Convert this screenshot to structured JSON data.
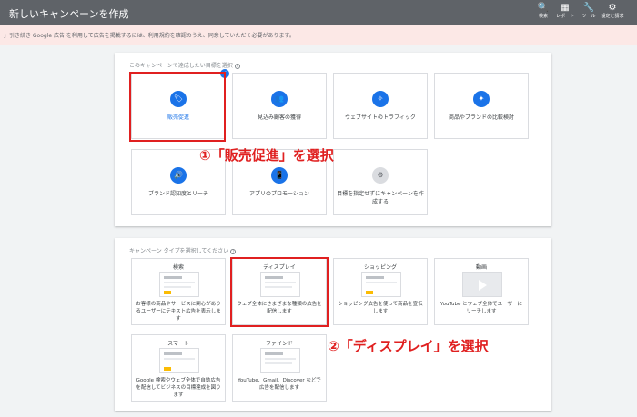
{
  "header": {
    "title": "新しいキャンペーンを作成",
    "tools": [
      {
        "icon": "search-icon",
        "glyph": "🔍",
        "label": "検索"
      },
      {
        "icon": "report-icon",
        "glyph": "▦",
        "label": "レポート"
      },
      {
        "icon": "wrench-icon",
        "glyph": "🔧",
        "label": "ツール"
      },
      {
        "icon": "gear-icon",
        "glyph": "⚙",
        "label": "設定と請求"
      }
    ]
  },
  "notice": {
    "text": "」引き続き Google 広告 を利用して広告を掲載するには、利用規約を確認のうえ、同意していただく必要があります。"
  },
  "objective_section": {
    "heading": "このキャンペーンで達成したい目標を選択",
    "help_glyph": "?",
    "items": [
      {
        "label": "販売促進",
        "icon": "tag-icon",
        "glyph": "🏷",
        "selected": true
      },
      {
        "label": "見込み顧客の獲得",
        "icon": "people-icon",
        "glyph": "👥",
        "selected": false
      },
      {
        "label": "ウェブサイトのトラフィック",
        "icon": "cursor-click-icon",
        "glyph": "✧",
        "selected": false
      },
      {
        "label": "商品やブランドの比較検討",
        "icon": "sparkle-icon",
        "glyph": "✦",
        "selected": false
      },
      {
        "label": "ブランド認知度とリーチ",
        "icon": "speaker-icon",
        "glyph": "🔊",
        "selected": false
      },
      {
        "label": "アプリのプロモーション",
        "icon": "phone-icon",
        "glyph": "📱",
        "selected": false
      },
      {
        "label": "目標を指定せずにキャンペーンを作成する",
        "icon": "gear-icon",
        "glyph": "⚙",
        "selected": false
      }
    ],
    "selected_check": "✓"
  },
  "campaign_type_section": {
    "heading": "キャンペーン タイプを選択してください",
    "help_glyph": "?",
    "items": [
      {
        "title": "検索",
        "description": "お客様の商品やサービスに関心がありるユーザーにテキスト広告を表示します",
        "thumb": "text-ad"
      },
      {
        "title": "ディスプレイ",
        "description": "ウェブ全体にさまざまな種類の広告を配信します",
        "thumb": "display"
      },
      {
        "title": "ショッピング",
        "description": "ショッピング広告を使って商品を宣伝します",
        "thumb": "shopping"
      },
      {
        "title": "動画",
        "description": "YouTube とウェブ全体でユーザーにリーチします",
        "thumb": "video"
      },
      {
        "title": "スマート",
        "description": "Google 検索やウェブ全体で自動広告を配信してビジネスの目標達成を図ります",
        "thumb": "smart"
      },
      {
        "title": "ファインド",
        "description": "YouTube、Gmail、Discover などで広告を配信します",
        "thumb": "discovery"
      }
    ]
  },
  "annotations": {
    "step1": "①「販売促進」を選択",
    "step2": "②「ディスプレイ」を選択"
  },
  "colors": {
    "topbar": "#5f6368",
    "accent": "#1a73e8",
    "annotation_red": "#e02020",
    "notice_bg": "#fce8e6"
  }
}
